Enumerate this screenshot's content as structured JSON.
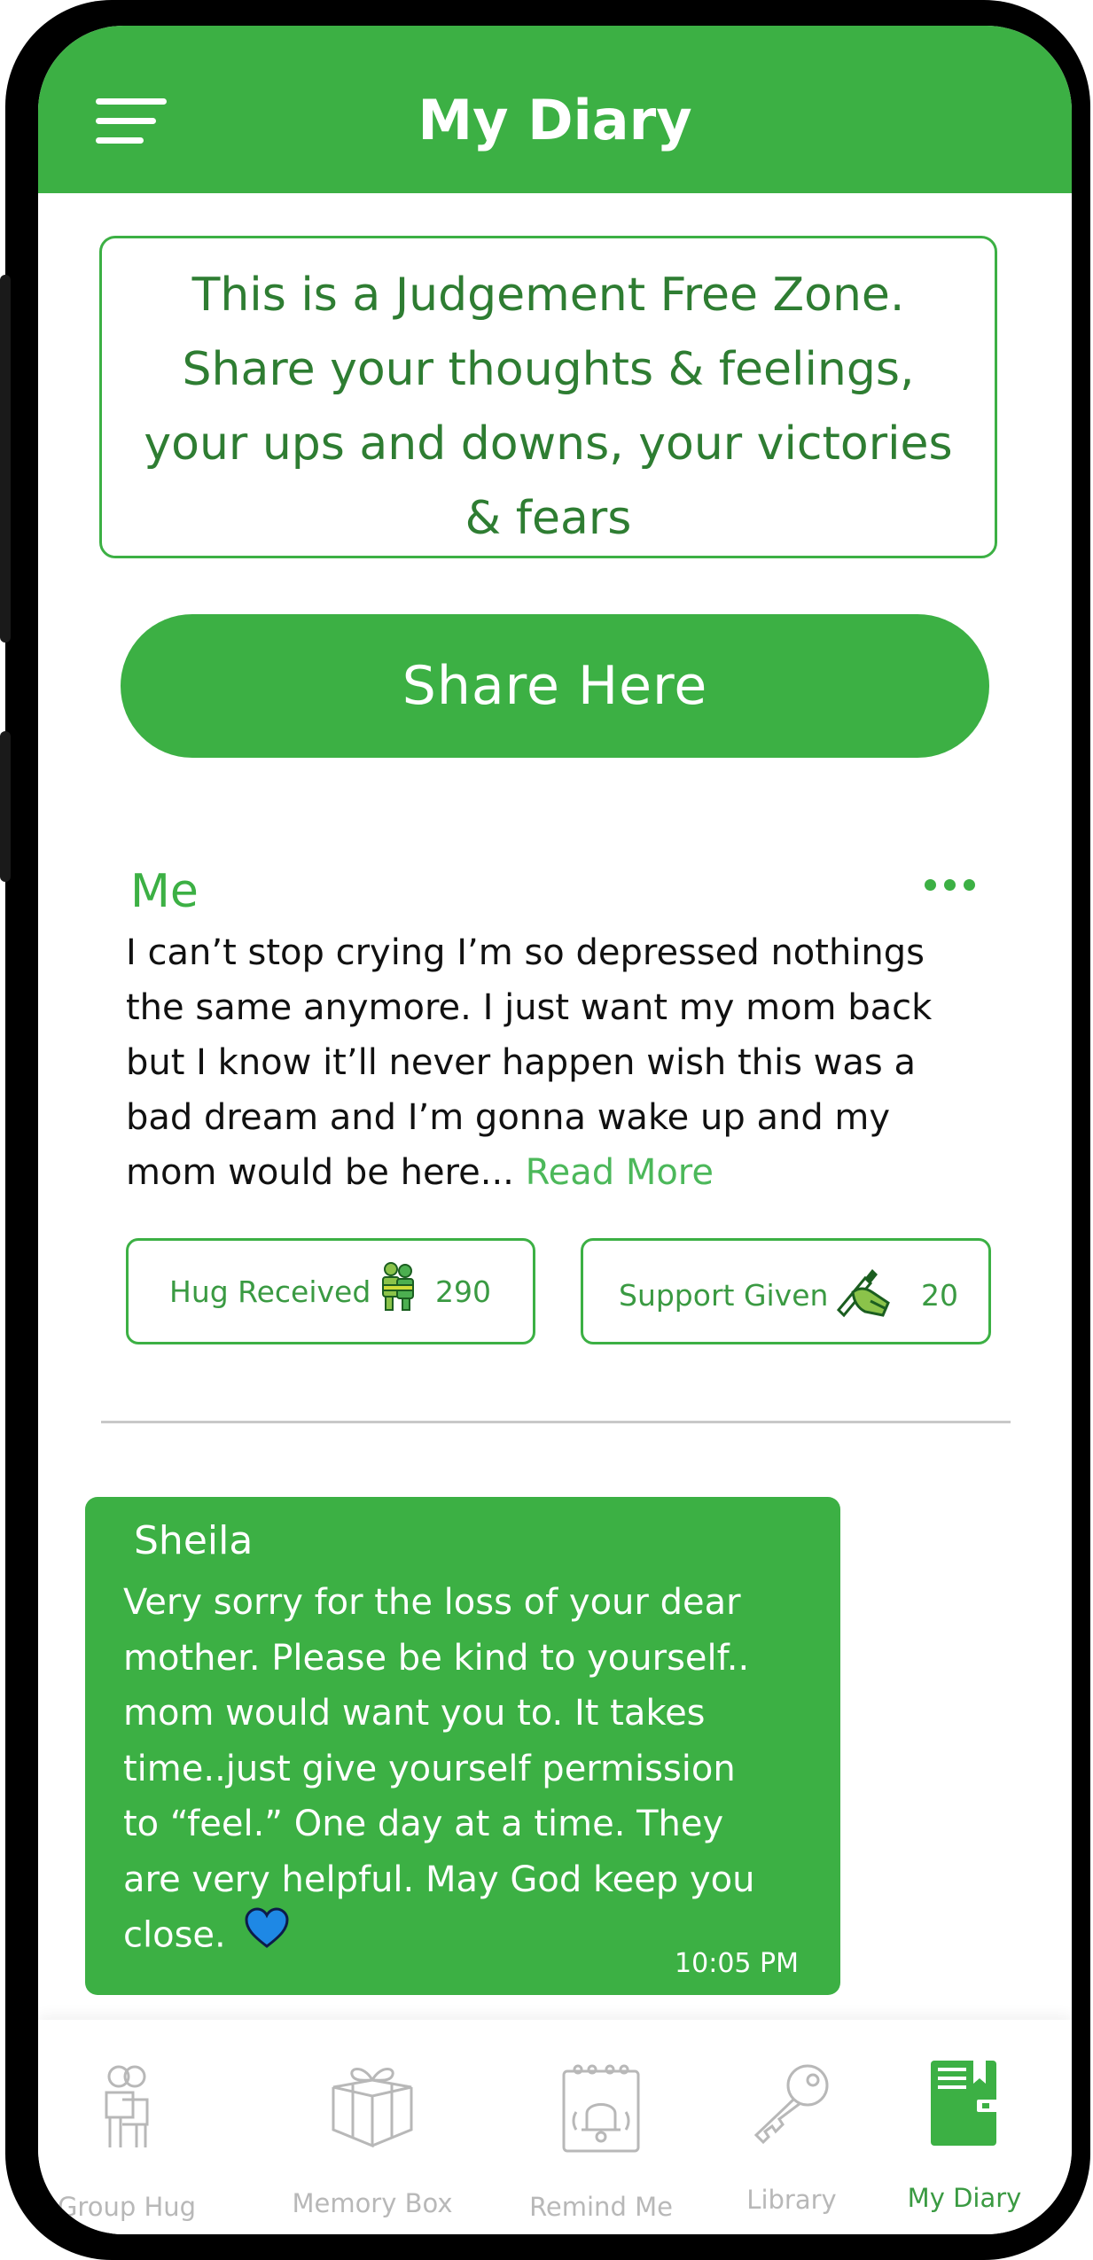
{
  "header": {
    "title": "My Diary"
  },
  "banner": {
    "text": "This is a Judgement Free Zone. Share your thoughts & feelings, your ups and downs, your victories & fears"
  },
  "share_button": {
    "label": "Share Here"
  },
  "post": {
    "author": "Me",
    "body": "I can’t stop crying I’m so depressed nothings the same anymore. I just want my mom back but I know it’ll never happen wish this was a bad dream and I’m gonna wake up and my mom would be here...",
    "read_more": "Read More",
    "hug": {
      "label": "Hug Received",
      "count": "290",
      "icon": "hug-icon"
    },
    "support": {
      "label": "Support Given",
      "count": "20",
      "icon": "writing-hand-icon"
    }
  },
  "reply": {
    "author": "Sheila",
    "body": "Very sorry for the loss of your dear mother. Please be kind to yourself.. mom would want you to. It takes time..just give yourself permission to “feel.” One day at a time. They are very helpful. May God keep you close.",
    "time": "10:05 PM",
    "emoji": "blue-heart-icon"
  },
  "tabs": [
    {
      "label": "Group Hug",
      "icon": "group-hug-icon",
      "active": false
    },
    {
      "label": "Memory Box",
      "icon": "gift-box-icon",
      "active": false
    },
    {
      "label": "Remind Me",
      "icon": "bell-calendar-icon",
      "active": false
    },
    {
      "label": "Library",
      "icon": "key-icon",
      "active": false
    },
    {
      "label": "My Diary",
      "icon": "diary-icon",
      "active": true
    }
  ],
  "colors": {
    "primary": "#3cb044",
    "text_green": "#2e7d32",
    "inactive": "#b8b8b8"
  }
}
